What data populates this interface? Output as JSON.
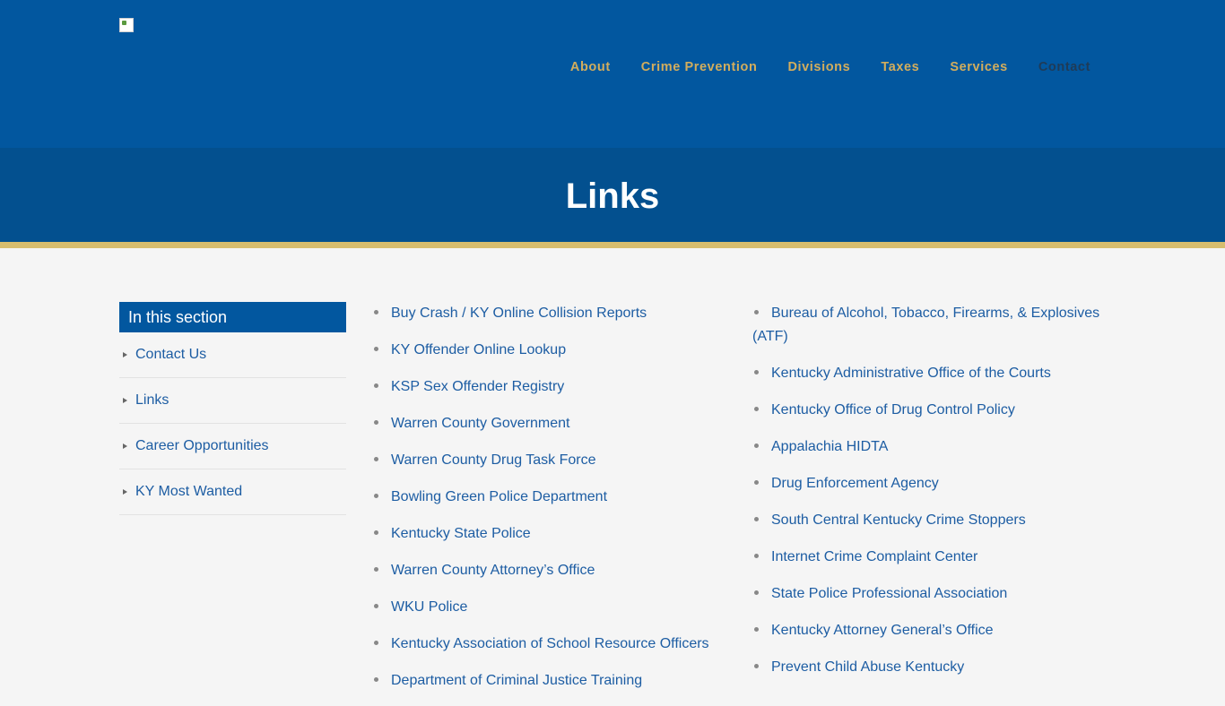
{
  "nav": {
    "items": [
      {
        "label": "About"
      },
      {
        "label": "Crime Prevention"
      },
      {
        "label": "Divisions"
      },
      {
        "label": "Taxes"
      },
      {
        "label": "Services"
      },
      {
        "label": "Contact",
        "active": true
      }
    ]
  },
  "page": {
    "title": "Links"
  },
  "sidebar": {
    "heading": "In this section",
    "items": [
      {
        "label": "Contact Us"
      },
      {
        "label": "Links"
      },
      {
        "label": "Career Opportunities"
      },
      {
        "label": "KY Most Wanted"
      }
    ]
  },
  "links": {
    "left": [
      "Buy Crash / KY Online Collision Reports",
      "KY Offender Online Lookup",
      "KSP Sex Offender Registry",
      "Warren County Government",
      "Warren County Drug Task Force",
      "Bowling Green Police Department",
      "Kentucky State Police",
      "Warren County Attorney’s Office",
      "WKU Police",
      "Kentucky Association of School Resource Officers",
      "Department of Criminal Justice Training"
    ],
    "right": [
      "Bureau of Alcohol, Tobacco, Firearms, & Explosives (ATF)",
      "Kentucky Administrative Office of the Courts",
      "Kentucky Office of Drug Control Policy",
      "Appalachia HIDTA",
      "Drug Enforcement Agency",
      "South Central Kentucky Crime Stoppers",
      "Internet Crime Complaint Center",
      "State Police Professional Association",
      "Kentucky Attorney General’s Office",
      "Prevent Child Abuse Kentucky"
    ]
  },
  "colors": {
    "header": "#02579f",
    "banner": "#03508f",
    "accent": "#d7bd6e",
    "nav_text": "#d2ad5d",
    "link": "#1d5da3"
  },
  "icons": {
    "logo": "broken-image-icon"
  }
}
